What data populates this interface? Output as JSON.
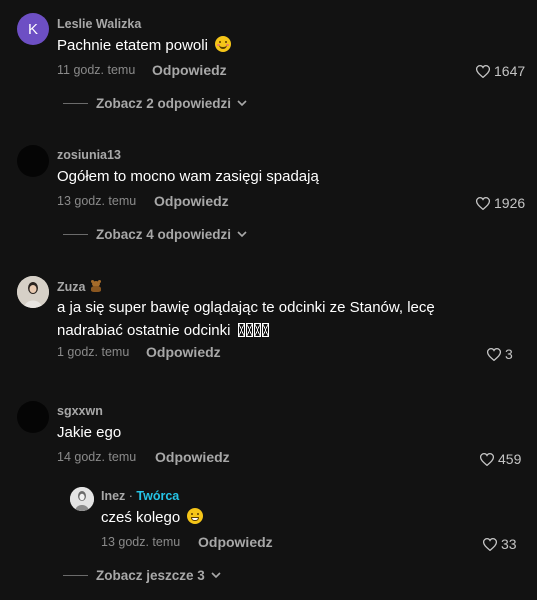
{
  "comments": [
    {
      "username": "Leslie Walizka",
      "avatar_letter": "K",
      "avatar_color": "#6d4fc4",
      "text": "Pachnie etatem powoli",
      "emoji": "smiling-face-emoji",
      "time": "11 godz. temu",
      "reply_label": "Odpowiedz",
      "likes": "1647",
      "view_replies": "Zobacz 2 odpowiedzi"
    },
    {
      "username": "zosiunia13",
      "text": "Ogółem to mocno wam zasięgi spadają",
      "time": "13 godz. temu",
      "reply_label": "Odpowiedz",
      "likes": "1926",
      "view_replies": "Zobacz 4 odpowiedzi"
    },
    {
      "username": "Zuza",
      "username_emoji": "teddy-bear-emoji",
      "text_line1": "a ja się super bawię oglądając te odcinki ze Stanów, lecę",
      "text_line2": "nadrabiać ostatnie odcinki",
      "time": "1 godz. temu",
      "reply_label": "Odpowiedz",
      "likes": "3"
    },
    {
      "username": "sgxxwn",
      "text": "Jakie ego",
      "time": "14 godz. temu",
      "reply_label": "Odpowiedz",
      "likes": "459",
      "reply": {
        "username": "Inez",
        "separator": " · ",
        "badge": "Twórca",
        "text": "cześ kolego",
        "emoji": "grinning-face-emoji",
        "time": "13 godz. temu",
        "reply_label": "Odpowiedz",
        "likes": "33"
      },
      "view_replies": "Zobacz jeszcze 3"
    }
  ],
  "colors": {
    "background": "#121212",
    "text": "#ffffff",
    "muted": "#a8a8a8",
    "creator_badge": "#25c4e6"
  },
  "icons": {
    "like": "heart-outline-icon",
    "expand": "chevron-down-icon"
  }
}
